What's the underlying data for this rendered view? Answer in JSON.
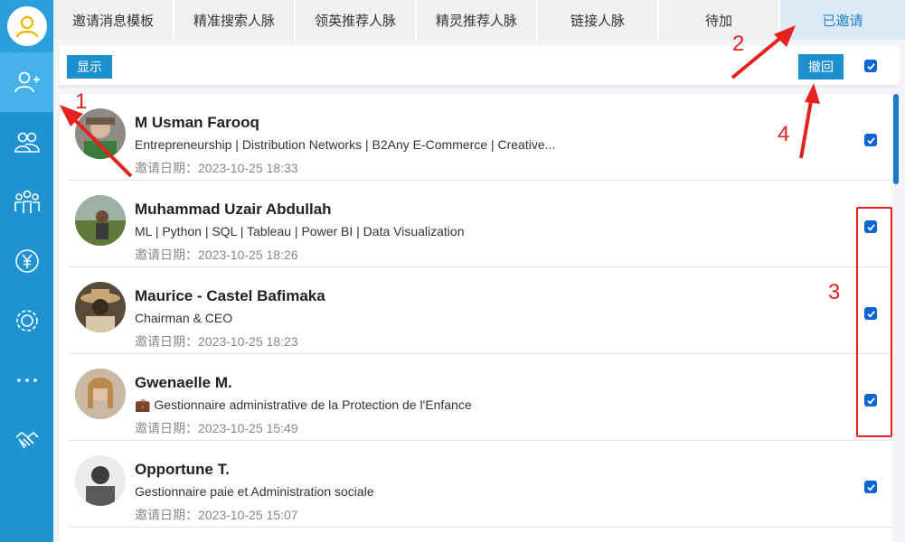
{
  "sidebar": {
    "items": [
      {
        "icon": "add-user-icon",
        "active": true
      },
      {
        "icon": "contacts-icon",
        "active": false
      },
      {
        "icon": "group-icon",
        "active": false
      },
      {
        "icon": "yen-icon",
        "active": false
      },
      {
        "icon": "gear-icon",
        "active": false
      },
      {
        "icon": "more-icon",
        "active": false
      },
      {
        "icon": "handshake-icon",
        "active": false
      }
    ]
  },
  "tabs": [
    {
      "label": "邀请消息模板",
      "active": false
    },
    {
      "label": "精准搜索人脉",
      "active": false
    },
    {
      "label": "领英推荐人脉",
      "active": false
    },
    {
      "label": "精灵推荐人脉",
      "active": false
    },
    {
      "label": "链接人脉",
      "active": false
    },
    {
      "label": "待加",
      "active": false
    },
    {
      "label": "已邀请",
      "active": true
    }
  ],
  "toolbar": {
    "show_label": "显示",
    "withdraw_label": "撤回",
    "select_all_checked": true
  },
  "date_label": "邀请日期：",
  "invites": [
    {
      "name": "M Usman Farooq",
      "title": "Entrepreneurship | Distribution Networks | B2Any E-Commerce | Creative...",
      "date": "2023-10-25 18:33",
      "checked": true
    },
    {
      "name": "Muhammad Uzair Abdullah",
      "title": "ML | Python | SQL | Tableau | Power BI | Data Visualization",
      "date": "2023-10-25 18:26",
      "checked": true
    },
    {
      "name": "Maurice - Castel Bafimaka",
      "title": "Chairman & CEO",
      "date": "2023-10-25 18:23",
      "checked": true
    },
    {
      "name": "Gwenaelle M.",
      "title": "💼 Gestionnaire administrative de la Protection de l'Enfance",
      "date": "2023-10-25 15:49",
      "checked": true
    },
    {
      "name": "Opportune T.",
      "title": "Gestionnaire paie et Administration sociale",
      "date": "2023-10-25 15:07",
      "checked": true
    }
  ],
  "annotations": {
    "labels": [
      "1",
      "2",
      "3",
      "4"
    ],
    "color": "#e4231f"
  },
  "colors": {
    "sidebar": "#1f93d1",
    "sidebar_active": "#45b3ea",
    "accent": "#1c8fcf",
    "checkbox": "#0a66d6",
    "annotation": "#e4231f"
  }
}
